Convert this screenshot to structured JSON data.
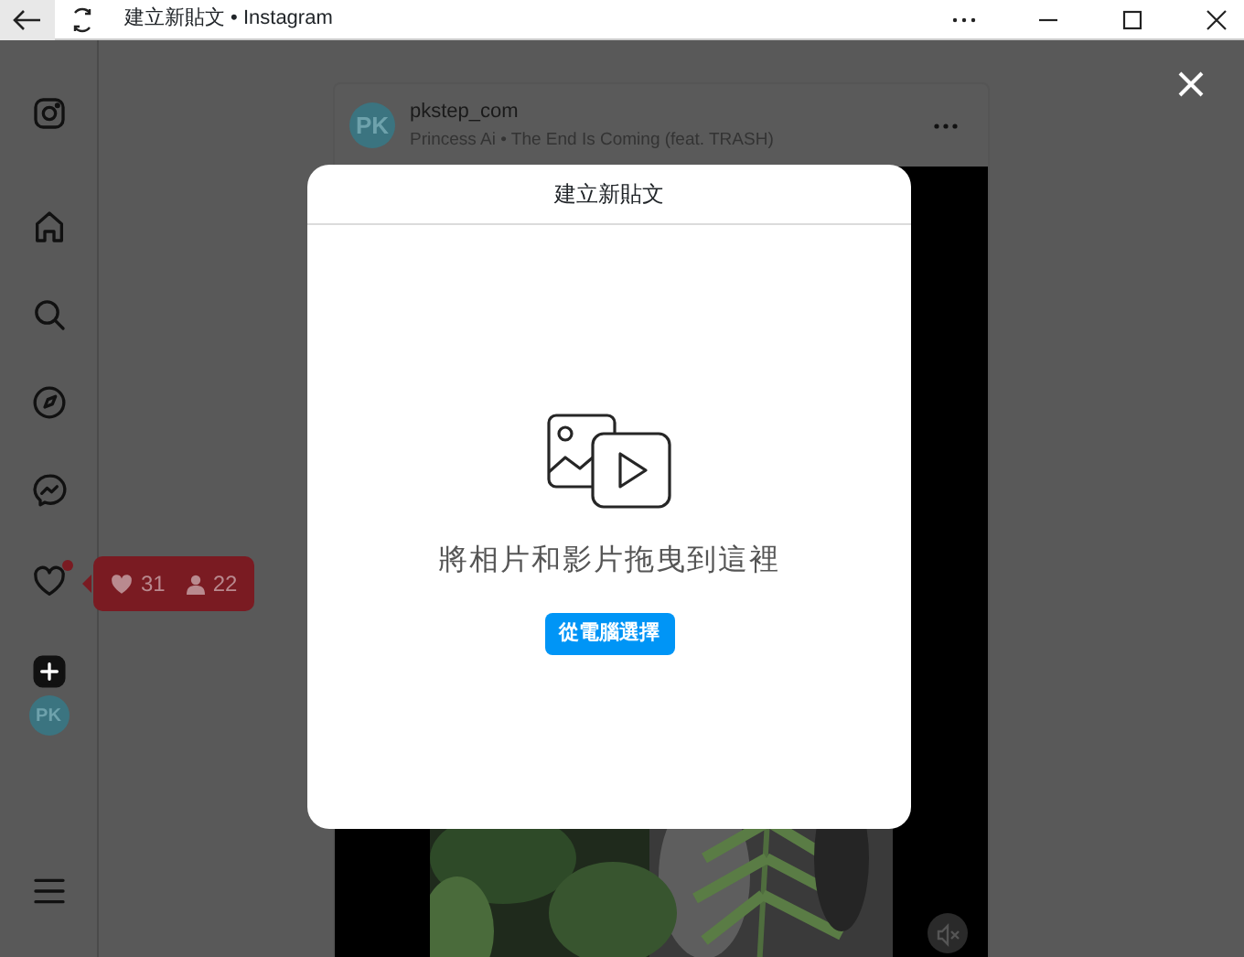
{
  "window": {
    "title": "建立新貼文 • Instagram"
  },
  "sidebar": {
    "items": [
      {
        "kind": "logo"
      },
      {
        "kind": "home"
      },
      {
        "kind": "search"
      },
      {
        "kind": "explore"
      },
      {
        "kind": "messenger"
      },
      {
        "kind": "heart",
        "badge": true
      },
      {
        "kind": "create"
      },
      {
        "kind": "avatar",
        "initials": "PK"
      }
    ],
    "menu": {
      "kind": "menu"
    }
  },
  "notification_tooltip": {
    "likes": "31",
    "followers": "22"
  },
  "post": {
    "avatar_initials": "PK",
    "username": "pkstep_com",
    "subtitle": "Princess Ai • The End Is Coming (feat. TRASH)",
    "video": {
      "kind": "picture",
      "muted": true
    }
  },
  "modal": {
    "title": "建立新貼文",
    "prompt": "將相片和影片拖曳到這裡",
    "button": "從電腦選擇"
  }
}
